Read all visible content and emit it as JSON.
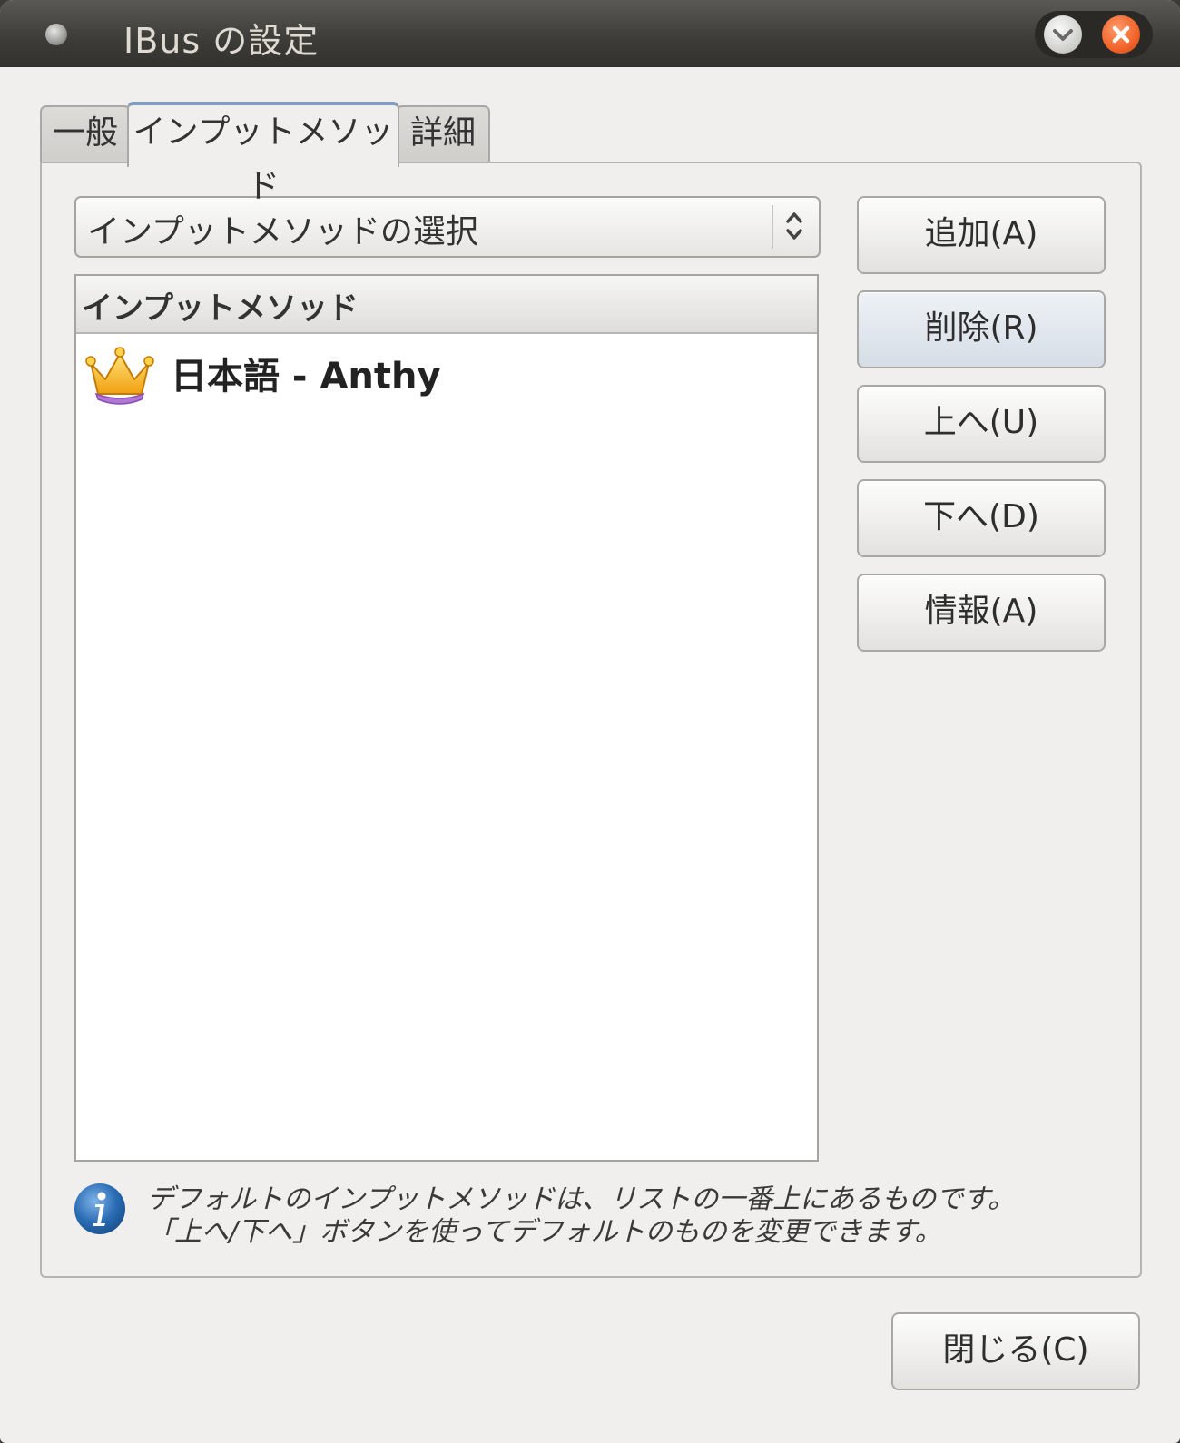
{
  "window": {
    "title": "IBus の設定"
  },
  "tabs": [
    {
      "label": "一般"
    },
    {
      "label": "インプットメソッド"
    },
    {
      "label": "詳細"
    }
  ],
  "input_method_selector": {
    "label": "インプットメソッドの選択"
  },
  "list": {
    "header": "インプットメソッド",
    "items": [
      {
        "label": "日本語 - Anthy",
        "icon": "crown-icon"
      }
    ]
  },
  "buttons": {
    "add": "追加(A)",
    "remove": "削除(R)",
    "up": "上へ(U)",
    "down": "下へ(D)",
    "info": "情報(A)",
    "close": "閉じる(C)"
  },
  "info": {
    "line1": "デフォルトのインプットメソッドは、リストの一番上にあるものです。",
    "line2": "「上へ/下へ」ボタンを使ってデフォルトのものを変更できます。"
  },
  "colors": {
    "titlebar": "#3c3b37",
    "window_bg": "#f0efed",
    "close_button": "#f2642a",
    "info_blue": "#2a6db4"
  }
}
